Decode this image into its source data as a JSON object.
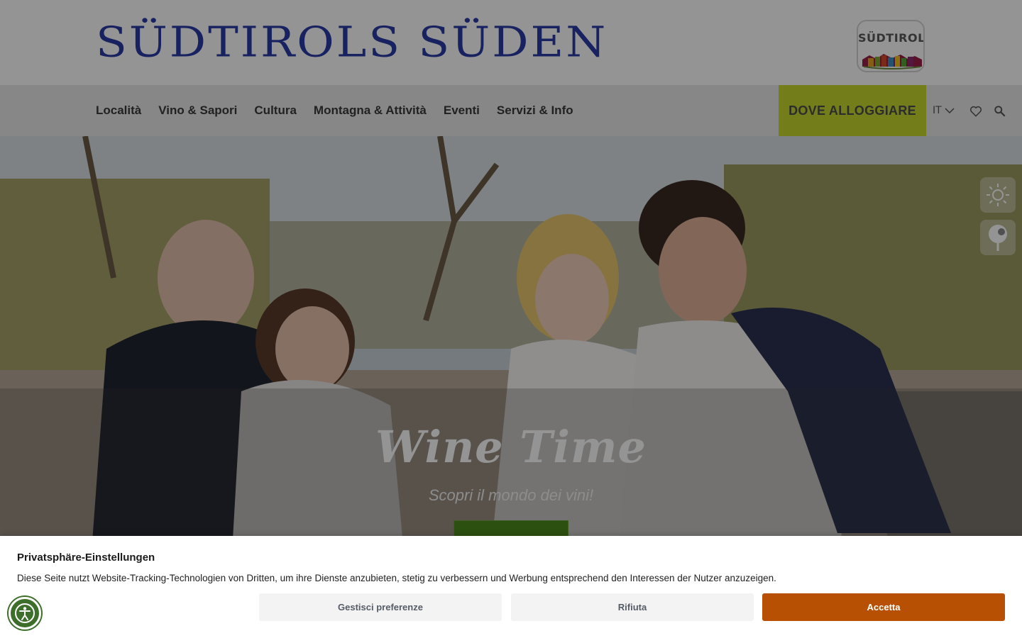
{
  "header": {
    "brand": "SÜDTIROLS SÜDEN",
    "suedtirol_logo_text": "SÜDTIROL"
  },
  "nav": {
    "items": [
      {
        "label": "Località"
      },
      {
        "label": "Vino & Sapori"
      },
      {
        "label": "Cultura"
      },
      {
        "label": "Montagna & Attività"
      },
      {
        "label": "Eventi"
      },
      {
        "label": "Servizi & Info"
      }
    ],
    "cta": "DOVE ALLOGGIARE",
    "language": "IT"
  },
  "hero": {
    "title": "Wine Time",
    "subtitle": "Scopri il mondo dei vini!"
  },
  "side_icons": [
    "sun-icon",
    "map-pin-icon"
  ],
  "cookie": {
    "title": "Privatsphäre-Einstellungen",
    "text": "Diese Seite nutzt Website-Tracking-Technologien von Dritten, um ihre Dienste anzubieten, stetig zu verbessern und Werbung entsprechend den Interessen der Nutzer anzuzeigen.",
    "buttons": {
      "preferences": "Gestisci preferenze",
      "reject": "Rifiuta",
      "accept": "Accetta"
    }
  },
  "colors": {
    "brand_blue": "#2b3ba7",
    "cta_green": "#c6d92e",
    "accept_orange": "#b75003",
    "a11y_green": "#3d6e2a"
  }
}
